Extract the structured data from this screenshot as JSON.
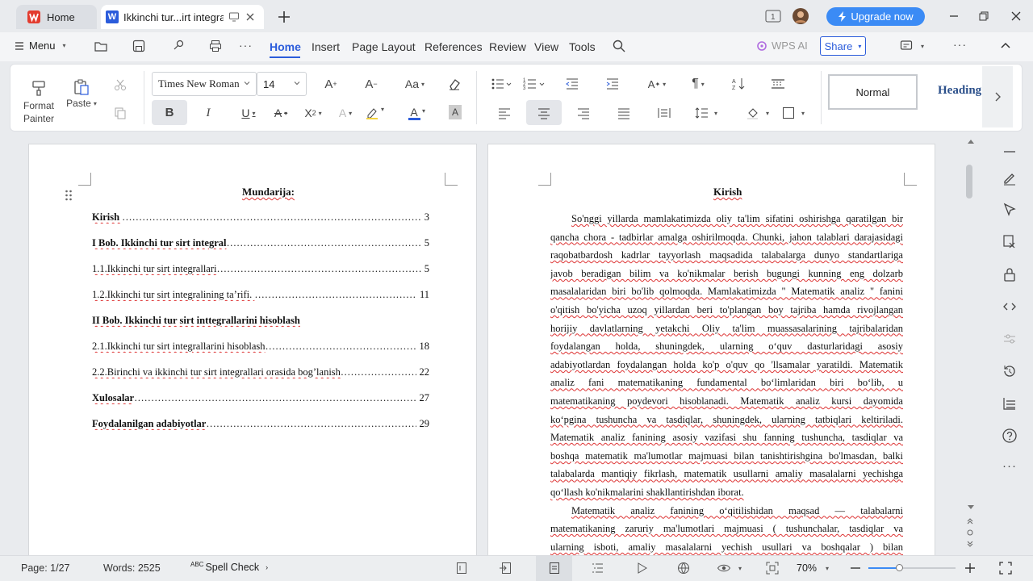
{
  "titlebar": {
    "home_tab": "Home",
    "doc_tab": "Ikkinchi tur...irt integral",
    "upgrade_label": "Upgrade now",
    "accent": "#3b8bf5"
  },
  "menubar": {
    "menu_label": "Menu",
    "tabs": [
      "Home",
      "Insert",
      "Page Layout",
      "References",
      "Review",
      "View",
      "Tools"
    ],
    "wps_ai": "WPS AI",
    "share": "Share",
    "active_color": "#2b5cdb"
  },
  "ribbon": {
    "format_painter": "Format Painter",
    "paste": "Paste",
    "font_name": "Times New Roman",
    "font_size": "14",
    "styles": [
      "Normal",
      "Heading"
    ]
  },
  "left_page": {
    "title": "Mundarija:",
    "toc": [
      {
        "text": "Kirish ",
        "page": "3"
      },
      {
        "text": "I Bob. Ikkinchi tur sirt integral",
        "page": "5"
      },
      {
        "text": "1.1.Ikkinchi tur sirt integrallari",
        "page": "5"
      },
      {
        "text": "1.2.Ikkinchi tur sirt integralining ta’rifi. ",
        "page": "11"
      },
      {
        "text": "II Bob. Ikkinchi tur sirt inttegrallarini hisoblash",
        "page": ""
      },
      {
        "text": "2.1.Ikkinchi tur sirt integrallarini hisoblash",
        "page": "18"
      },
      {
        "text": "2.2.Birinchi va ikkinchi tur sirt integrallari orasida bog’lanish",
        "page": "22"
      },
      {
        "text": "Xulosalar",
        "page": "27"
      },
      {
        "text": "Foydalanilgan adabiyotlar",
        "page": "29"
      }
    ]
  },
  "right_page": {
    "title": "Kirish",
    "lines": [
      "So'nggi yillarda mamlakatimizda oliy ta'lim sifatini oshirishga qaratilgan bir",
      "qancha chora - tadbirlar amalga oshirilmoqda. Chunki, jahon talablari darajasidagi",
      "raqobatbardosh kadrlar tayyorlash maqsadida talabalarga dunyo standartlariga",
      "javob beradigan bilim va ko'nikmalar berish bugungi kunning eng dolzarb",
      "masalalaridan biri bo'lib qolmoqda. Mamlakatimizda \" Matematik analiz \" fanini",
      "o'qitish bo'yicha uzoq yillardan beri to'plangan boy tajriba hamda rivojlangan",
      "horijiy davlatlarning yetakchi Oliy ta'lim muassasalarining tajribalaridan",
      "foydalangan holda, shuningdek, ularning o‘quv dasturlaridagi asosiy",
      "adabiyotlardan foydalangan holda ko'p o'quv qo 'llsamalar yaratildi. Matematik",
      "analiz fani matematikaning fundamental bo‘limlaridan biri bo‘lib, u",
      "matematikaning poydevori hisoblanadi. Matematik analiz kursi dayomida",
      "ko‘pgina tushuncha va tasdiqlar, shuningdek, ularning tatbiqlari keltiriladi.",
      "Matematik analiz fanining asosiy vazifasi shu fanning tushuncha, tasdiqlar va",
      "boshqa matematik ma'lumotlar majmuasi bilan tanishtirishgina bo'lmasdan, balki",
      "talabalarda mantiqiy fikrlash, matematik usullarni amaliy masalalarni yechishga",
      "qo‘llash ko'nikmalarini shakllantirishdan iborat.",
      "Matematik analiz fanining o‘qitilishidan maqsad — talabalarni",
      "matematikaning zaruriy ma'lumotlari majmuasi ( tushunchalar, tasdiqlar va",
      "ularning isboti, amaliy masalalarni yechish usullari va boshqalar ) bilan"
    ]
  },
  "statusbar": {
    "page": "Page: 1/27",
    "words": "Words: 2525",
    "spell_check": "Spell Check",
    "zoom": "70%",
    "zoom_fraction": 0.35
  }
}
